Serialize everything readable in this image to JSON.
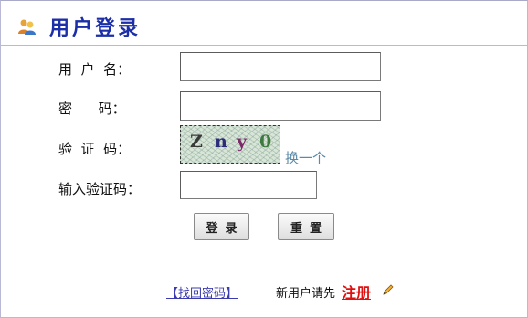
{
  "header": {
    "title": "用户登录",
    "icon": "users-icon"
  },
  "form": {
    "username_label": "用  户  名：",
    "password_label": "密      码：",
    "captcha_label": "验  证  码：",
    "captcha_input_label": "输入验证码：",
    "username_value": "",
    "password_value": "",
    "captcha_value": ""
  },
  "captcha": {
    "chars": [
      "Z",
      "n",
      "y",
      "0"
    ],
    "colors": [
      "#3a3a3a",
      "#2b2b7a",
      "#7a2b6a",
      "#3e7a3e"
    ],
    "refresh_label": "换一个"
  },
  "buttons": {
    "login": "登录",
    "reset": "重置"
  },
  "footer": {
    "recover_label": "【找回密码】",
    "new_user_text": "新用户请先",
    "register_label": "注册",
    "register_icon": "pencil-icon"
  }
}
